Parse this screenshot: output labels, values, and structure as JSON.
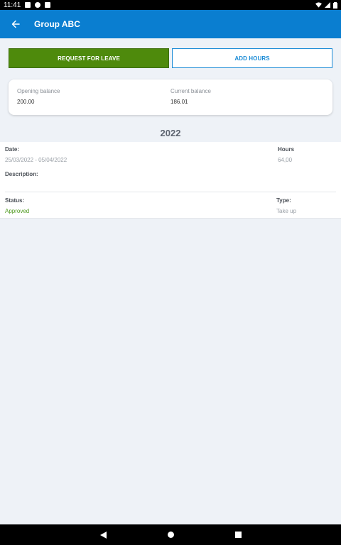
{
  "status_bar": {
    "time": "11:41"
  },
  "app_bar": {
    "title": "Group ABC"
  },
  "buttons": {
    "request_leave": "REQUEST FOR LEAVE",
    "add_hours": "ADD HOURS"
  },
  "balance": {
    "opening_label": "Opening balance",
    "opening_value": "200.00",
    "current_label": "Current balance",
    "current_value": "186.01"
  },
  "year": "2022",
  "entry": {
    "date_label": "Date:",
    "date_value": "25/03/2022 - 05/04/2022",
    "hours_label": "Hours",
    "hours_value": "64,00",
    "description_label": "Description:",
    "status_label": "Status:",
    "status_value": "Approved",
    "type_label": "Type:",
    "type_value": "Take up"
  },
  "colors": {
    "app_bar": "#0a7ed0",
    "leave_button": "#4e8a0c",
    "approved": "#4e9a1e"
  }
}
